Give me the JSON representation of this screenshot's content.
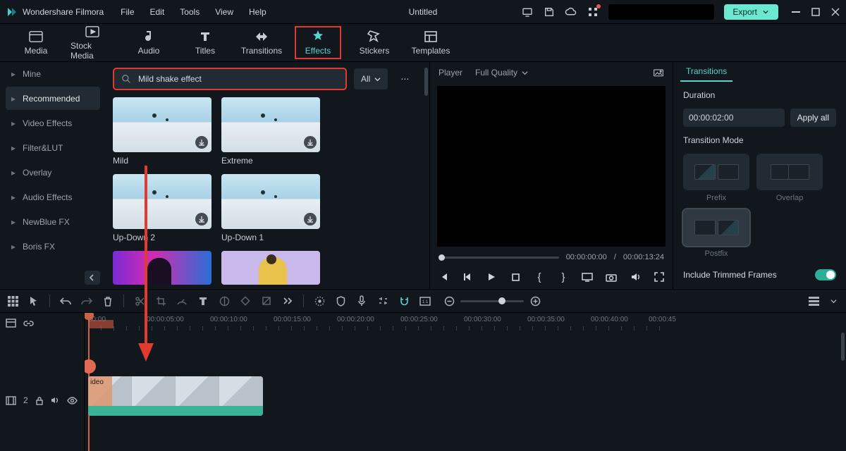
{
  "app_name": "Wondershare Filmora",
  "menus": [
    "File",
    "Edit",
    "Tools",
    "View",
    "Help"
  ],
  "doc_title": "Untitled",
  "export_label": "Export",
  "tooltabs": [
    {
      "id": "media",
      "label": "Media"
    },
    {
      "id": "stock",
      "label": "Stock Media"
    },
    {
      "id": "audio",
      "label": "Audio"
    },
    {
      "id": "titles",
      "label": "Titles"
    },
    {
      "id": "transitions",
      "label": "Transitions"
    },
    {
      "id": "effects",
      "label": "Effects"
    },
    {
      "id": "stickers",
      "label": "Stickers"
    },
    {
      "id": "templates",
      "label": "Templates"
    }
  ],
  "categories": [
    "Mine",
    "Recommended",
    "Video Effects",
    "Filter&LUT",
    "Overlay",
    "Audio Effects",
    "NewBlue FX",
    "Boris FX"
  ],
  "search_value": "Mild shake effect",
  "filter_label": "All",
  "thumbs": [
    {
      "label": "Mild",
      "style": "sky"
    },
    {
      "label": "Extreme",
      "style": "sky"
    },
    {
      "label": "Up-Down 2",
      "style": "sky"
    },
    {
      "label": "Up-Down 1",
      "style": "sky"
    },
    {
      "label": "",
      "style": "neon"
    },
    {
      "label": "",
      "style": "yellow"
    }
  ],
  "player": {
    "tab": "Player",
    "quality": "Full Quality",
    "time": "00:00:00:00",
    "duration": "00:00:13:24",
    "sep": "/"
  },
  "transitions": {
    "tab": "Transitions",
    "duration_label": "Duration",
    "duration_value": "00:00:02:00",
    "apply_all": "Apply all",
    "mode_label": "Transition Mode",
    "modes": [
      "Prefix",
      "Overlap",
      "Postfix"
    ],
    "trimmed_label": "Include Trimmed Frames"
  },
  "ruler": [
    "00:00",
    "00:00:05:00",
    "00:00:10:00",
    "00:00:15:00",
    "00:00:20:00",
    "00:00:25:00",
    "00:00:30:00",
    "00:00:35:00",
    "00:00:40:00",
    "00:00:45"
  ],
  "clip_label": "ideo",
  "track_badge": "2"
}
